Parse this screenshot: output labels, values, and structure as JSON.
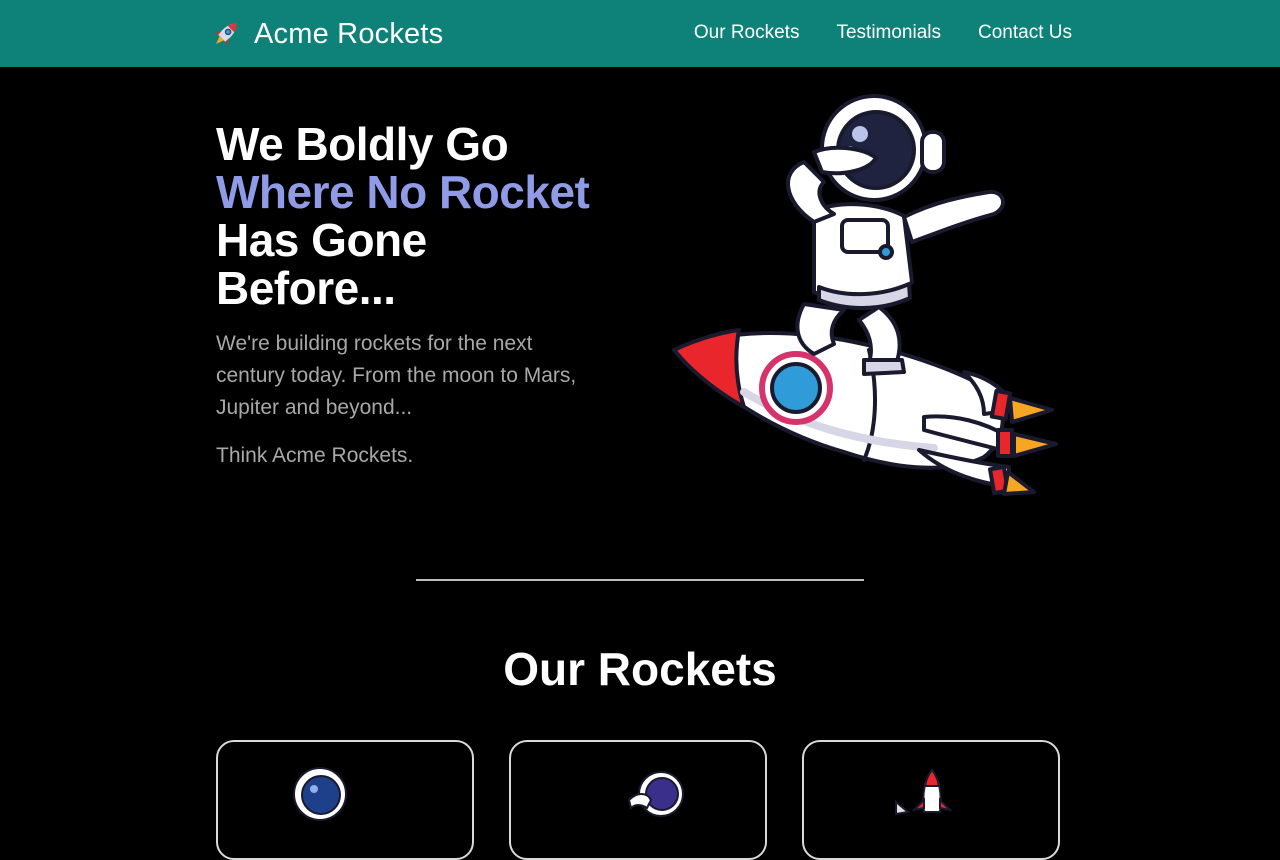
{
  "header": {
    "brand": "Acme Rockets",
    "brand_icon": "rocket-icon",
    "nav": [
      {
        "label": "Our Rockets"
      },
      {
        "label": "Testimonials"
      },
      {
        "label": "Contact Us"
      }
    ],
    "background_color": "#0e8278"
  },
  "hero": {
    "title_line1": "We Boldly Go",
    "title_line2": "Where No Rocket",
    "title_line3": "Has Gone",
    "title_line4": "Before...",
    "accent_color": "#8f9be6",
    "description": "We're building rockets for the next century today. From the moon to Mars, Jupiter and beyond...",
    "tagline": "Think Acme Rockets.",
    "illustration": "astronaut-riding-rocket-illustration"
  },
  "rockets_section": {
    "title": "Our Rockets",
    "cards": [
      {
        "icon": "astronaut-icon"
      },
      {
        "icon": "astronaut-icon"
      },
      {
        "icon": "rocket-icon"
      }
    ]
  }
}
